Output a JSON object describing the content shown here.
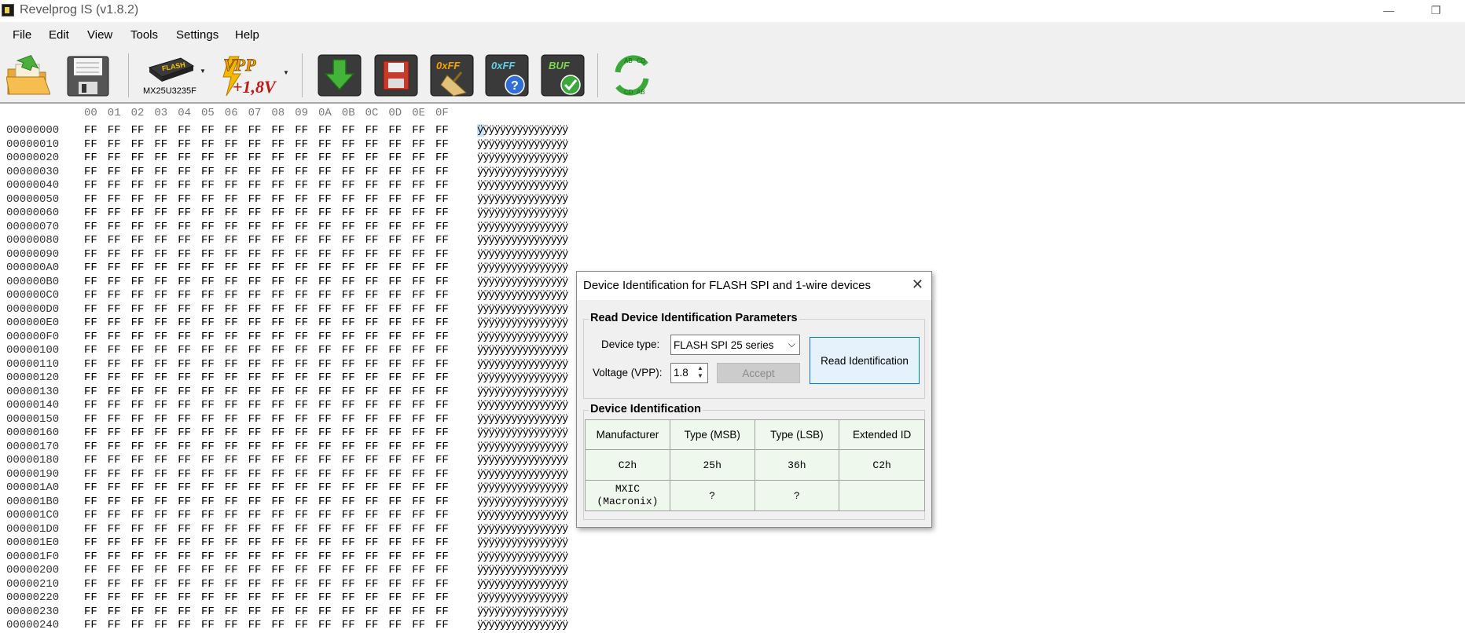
{
  "window": {
    "title": "Revelprog IS (v1.8.2)",
    "minimize_glyph": "—",
    "restore_glyph": "❐"
  },
  "menu": [
    "File",
    "Edit",
    "View",
    "Tools",
    "Settings",
    "Help"
  ],
  "toolbar": {
    "open_icon_text": "",
    "save_icon_text": "",
    "chip_label": "FLASH",
    "chip_name": "MX25U3235F",
    "vpp_label": "VPP",
    "vpp_value": "+1,8V",
    "blank_check_label": "0xFF",
    "verify_blank_label": "0xFF",
    "verify_buffer_label": "BUF",
    "swap_labels": [
      "AB",
      "CD",
      "CD",
      "AB"
    ]
  },
  "hex": {
    "column_headers": [
      "00",
      "01",
      "02",
      "03",
      "04",
      "05",
      "06",
      "07",
      "08",
      "09",
      "0A",
      "0B",
      "0C",
      "0D",
      "0E",
      "0F"
    ],
    "offsets": [
      "00000000",
      "00000010",
      "00000020",
      "00000030",
      "00000040",
      "00000050",
      "00000060",
      "00000070",
      "00000080",
      "00000090",
      "000000A0",
      "000000B0",
      "000000C0",
      "000000D0",
      "000000E0",
      "000000F0",
      "00000100",
      "00000110",
      "00000120",
      "00000130",
      "00000140",
      "00000150",
      "00000160",
      "00000170",
      "00000180",
      "00000190",
      "000001A0",
      "000001B0",
      "000001C0",
      "000001D0",
      "000001E0",
      "000001F0",
      "00000200",
      "00000210",
      "00000220",
      "00000230",
      "00000240"
    ],
    "byte_value": "FF",
    "ascii_row": "ÿÿÿÿÿÿÿÿÿÿÿÿÿÿÿÿ"
  },
  "dialog": {
    "title": "Device Identification for FLASH SPI and 1-wire devices",
    "close_glyph": "✕",
    "read_group_label": "Read Device Identification Parameters",
    "device_type_label": "Device type:",
    "device_type_value": "FLASH SPI 25 series",
    "voltage_label": "Voltage (VPP):",
    "voltage_value": "1.8",
    "accept_label": "Accept",
    "read_button_label": "Read Identification",
    "ident_group_label": "Device Identification",
    "table": {
      "headers": [
        "Manufacturer",
        "Type (MSB)",
        "Type (LSB)",
        "Extended ID"
      ],
      "row1": [
        "C2h",
        "25h",
        "36h",
        "C2h"
      ],
      "row2": [
        "MXIC\n(Macronix)",
        "?",
        "?",
        ""
      ]
    }
  },
  "colors": {
    "toolbar_bg": "#f0f0f0",
    "table_bg": "#eef8ec",
    "read_button_bg": "#e5f1fb",
    "read_button_border": "#0078d7"
  }
}
